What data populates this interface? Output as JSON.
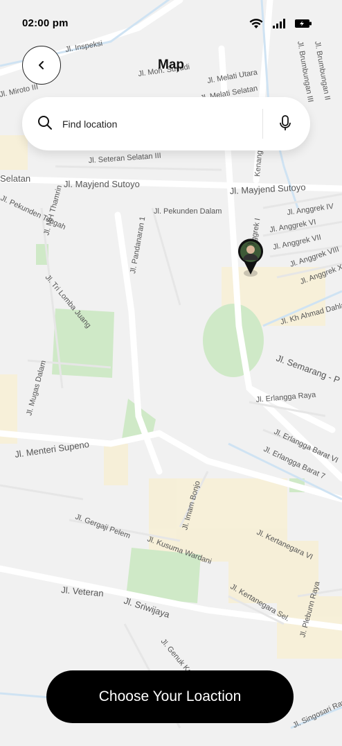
{
  "status_bar": {
    "time": "02:00 pm"
  },
  "header": {
    "title": "Map"
  },
  "search": {
    "placeholder": "Find location"
  },
  "map": {
    "street_labels": [
      "Jl. Inspeksi",
      "Jl. Moh. Suyudi",
      "Jl. Melati Utara",
      "Jl. Melati Selatan",
      "Jl. Brumbungan III",
      "Jl. Brumbungan II",
      "Jl. Seteran Selatan III",
      "Jl. Mayjend Sutoyo",
      "Jl. Mayjend Sutoyo",
      "Jl. Pekunden Dalam",
      "Jl. Pekunden Tengah",
      "Jl. MH Thamrin",
      "Jl. Pandanaran 1",
      "Jl. Anggrek IV",
      "Jl. Anggrek VI",
      "Jl. Anggrek VII",
      "Jl. Anggrek VIII",
      "Jl. Anggrek X",
      "Jl. Tri Lomba Juang",
      "Jl. Kh Ahmad Dahlan",
      "Jl. Semarang - P",
      "Jl. Erlangga Raya",
      "Jl. Mugas Dalam",
      "Jl. Erlangga Barat VI",
      "Jl. Erlangga Barat 7",
      "Jl. Menteri Supeno",
      "Jl. Imam Bonjo",
      "Jl. Gergaji Pelem",
      "Jl. Kusuma Wardani",
      "Jl. Kertanegara VI",
      "Jl. Kertanegara Sel.",
      "Jl. Veteran",
      "Jl. Sriwijaya",
      "Jl. Plebunn Raya",
      "Jl. Genuk Karang",
      "Jl. Singosari Raya",
      "Jl. Anggrek I",
      "Kenanga",
      "Jl. Miroto III",
      "Selatan"
    ]
  },
  "cta": {
    "label": "Choose Your Loaction"
  }
}
